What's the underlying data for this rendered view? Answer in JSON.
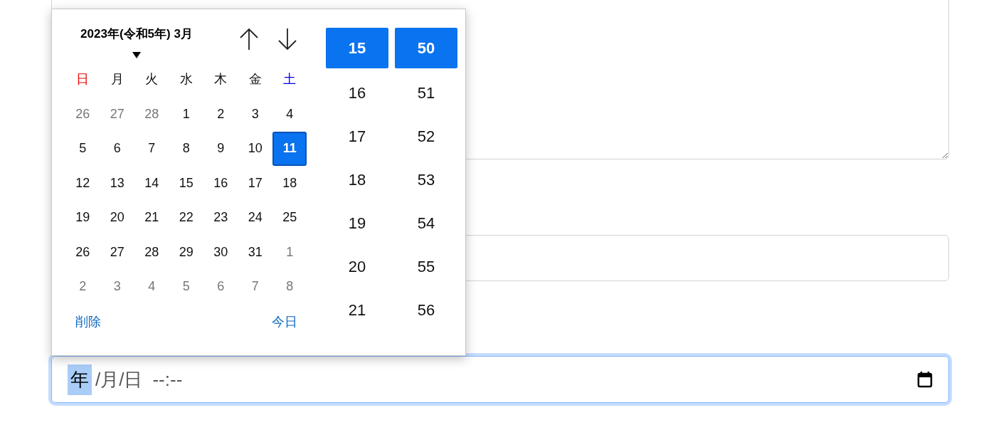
{
  "picker": {
    "month_label": "2023年(令和5年) 3月",
    "weekdays": [
      {
        "label": "日",
        "kind": "sunday"
      },
      {
        "label": "月",
        "kind": "weekday"
      },
      {
        "label": "火",
        "kind": "weekday"
      },
      {
        "label": "水",
        "kind": "weekday"
      },
      {
        "label": "木",
        "kind": "weekday"
      },
      {
        "label": "金",
        "kind": "weekday"
      },
      {
        "label": "土",
        "kind": "saturday"
      }
    ],
    "weeks": [
      [
        {
          "day": "26",
          "in_month": false,
          "selected": false
        },
        {
          "day": "27",
          "in_month": false,
          "selected": false
        },
        {
          "day": "28",
          "in_month": false,
          "selected": false
        },
        {
          "day": "1",
          "in_month": true,
          "selected": false
        },
        {
          "day": "2",
          "in_month": true,
          "selected": false
        },
        {
          "day": "3",
          "in_month": true,
          "selected": false
        },
        {
          "day": "4",
          "in_month": true,
          "selected": false
        }
      ],
      [
        {
          "day": "5",
          "in_month": true,
          "selected": false
        },
        {
          "day": "6",
          "in_month": true,
          "selected": false
        },
        {
          "day": "7",
          "in_month": true,
          "selected": false
        },
        {
          "day": "8",
          "in_month": true,
          "selected": false
        },
        {
          "day": "9",
          "in_month": true,
          "selected": false
        },
        {
          "day": "10",
          "in_month": true,
          "selected": false
        },
        {
          "day": "11",
          "in_month": true,
          "selected": true
        }
      ],
      [
        {
          "day": "12",
          "in_month": true,
          "selected": false
        },
        {
          "day": "13",
          "in_month": true,
          "selected": false
        },
        {
          "day": "14",
          "in_month": true,
          "selected": false
        },
        {
          "day": "15",
          "in_month": true,
          "selected": false
        },
        {
          "day": "16",
          "in_month": true,
          "selected": false
        },
        {
          "day": "17",
          "in_month": true,
          "selected": false
        },
        {
          "day": "18",
          "in_month": true,
          "selected": false
        }
      ],
      [
        {
          "day": "19",
          "in_month": true,
          "selected": false
        },
        {
          "day": "20",
          "in_month": true,
          "selected": false
        },
        {
          "day": "21",
          "in_month": true,
          "selected": false
        },
        {
          "day": "22",
          "in_month": true,
          "selected": false
        },
        {
          "day": "23",
          "in_month": true,
          "selected": false
        },
        {
          "day": "24",
          "in_month": true,
          "selected": false
        },
        {
          "day": "25",
          "in_month": true,
          "selected": false
        }
      ],
      [
        {
          "day": "26",
          "in_month": true,
          "selected": false
        },
        {
          "day": "27",
          "in_month": true,
          "selected": false
        },
        {
          "day": "28",
          "in_month": true,
          "selected": false
        },
        {
          "day": "29",
          "in_month": true,
          "selected": false
        },
        {
          "day": "30",
          "in_month": true,
          "selected": false
        },
        {
          "day": "31",
          "in_month": true,
          "selected": false
        },
        {
          "day": "1",
          "in_month": false,
          "selected": false
        }
      ],
      [
        {
          "day": "2",
          "in_month": false,
          "selected": false
        },
        {
          "day": "3",
          "in_month": false,
          "selected": false
        },
        {
          "day": "4",
          "in_month": false,
          "selected": false
        },
        {
          "day": "5",
          "in_month": false,
          "selected": false
        },
        {
          "day": "6",
          "in_month": false,
          "selected": false
        },
        {
          "day": "7",
          "in_month": false,
          "selected": false
        },
        {
          "day": "8",
          "in_month": false,
          "selected": false
        }
      ]
    ],
    "hours": [
      {
        "label": "15",
        "selected": true
      },
      {
        "label": "16",
        "selected": false
      },
      {
        "label": "17",
        "selected": false
      },
      {
        "label": "18",
        "selected": false
      },
      {
        "label": "19",
        "selected": false
      },
      {
        "label": "20",
        "selected": false
      },
      {
        "label": "21",
        "selected": false
      }
    ],
    "minutes": [
      {
        "label": "50",
        "selected": true
      },
      {
        "label": "51",
        "selected": false
      },
      {
        "label": "52",
        "selected": false
      },
      {
        "label": "53",
        "selected": false
      },
      {
        "label": "54",
        "selected": false
      },
      {
        "label": "55",
        "selected": false
      },
      {
        "label": "56",
        "selected": false
      }
    ],
    "clear_button": "削除",
    "today_button": "今日"
  },
  "datetime_field": {
    "segments": [
      {
        "text": "年",
        "selected": true
      },
      {
        "text": "/月/日",
        "selected": false
      },
      {
        "text": "--:--",
        "selected": false
      }
    ]
  }
}
